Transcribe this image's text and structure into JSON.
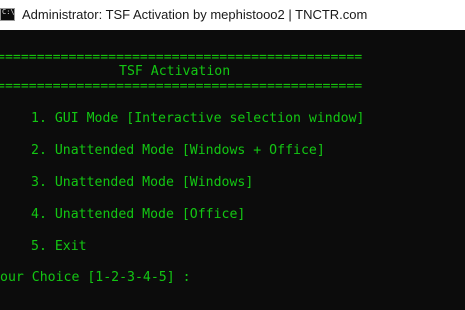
{
  "window": {
    "icon_name": "cmd-icon",
    "icon_glyph": "C:\\",
    "title": "Administrator:  TSF Activation by mephistooo2 | TNCTR.com"
  },
  "console": {
    "text_color": "#13c713",
    "background_color": "#0c0c0c",
    "separator_top": "==============================================",
    "heading": "TSF Activation",
    "separator_bottom": "==============================================",
    "options": [
      "1. GUI Mode [Interactive selection window]",
      "2. Unattended Mode [Windows + Office]",
      "3. Unattended Mode [Windows]",
      "4. Unattended Mode [Office]",
      "5. Exit"
    ],
    "prompt": "our Choice [1-2-3-4-5] :"
  }
}
